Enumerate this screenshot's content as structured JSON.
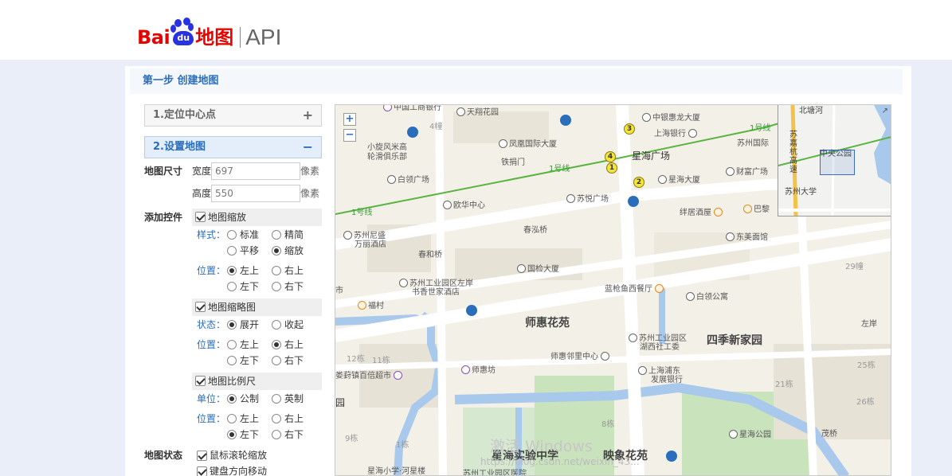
{
  "header": {
    "logo_bai": "Bai",
    "logo_du": "du",
    "logo_ditu": "地图",
    "logo_api": "API"
  },
  "step_title": "第一步 创建地图",
  "panel": {
    "section1": "1.定位中心点",
    "section1_sign": "+",
    "section2": "2.设置地图",
    "section2_sign": "−",
    "map_size_label": "地图尺寸",
    "width_label": "宽度：",
    "width_value": "697",
    "height_label": "高度：",
    "height_value": "550",
    "unit": "像素",
    "add_controls_label": "添加控件",
    "zoom_control": "地图缩放",
    "style_label": "样式：",
    "style_options": [
      "标准",
      "精简",
      "平移",
      "缩放"
    ],
    "position_label": "位置：",
    "position_options": [
      "左上",
      "右上",
      "左下",
      "右下"
    ],
    "overview_control": "地图缩略图",
    "state_label": "状态：",
    "state_options": [
      "展开",
      "收起"
    ],
    "scale_control": "地图比例尺",
    "scale_unit_label": "单位：",
    "scale_unit_options": [
      "公制",
      "英制"
    ],
    "map_state_label": "地图状态",
    "map_state_options": [
      "鼠标滚轮缩放",
      "键盘方向移动"
    ]
  },
  "map": {
    "zoom_in": "+",
    "zoom_out": "−",
    "labels": {
      "zhongguo_bank": "中国工商银行",
      "tianxiang": "天翔花园",
      "zhongyin": "中银惠龙大厦",
      "shanghai_bank": "上海银行",
      "suzhou_intl": "苏州国际",
      "caifu": "财富广场",
      "building_4": "4幢",
      "xiaoxuanfeng": "小旋风米高",
      "lunhua": "轮滑俱乐部",
      "fenghuang": "凤凰国际大厦",
      "tiexiu": "铁捐门",
      "xinghai_sq": "星海广场",
      "xinghai_tower": "星海大厦",
      "line1_a": "1号线",
      "line1_b": "1号线",
      "line1_c": "1号线",
      "bailing_sq": "白领广场",
      "suyue": "苏悦广场",
      "ouhua": "欧华中心",
      "banju": "绊居酒屋",
      "bakyo": "巴黎",
      "ninisheng": "苏州尼盛",
      "wanli": "万丽酒店",
      "chunliuqiao": "春泓桥",
      "chunhe": "春和桥",
      "dongmei": "东美面馆",
      "suzhou_park": "苏州工业园区左岸",
      "shuxiang": "书香世家酒店",
      "guojian": "国检大厦",
      "landyu": "蓝枪鱼西餐厅",
      "bailing_apt": "白领公寓",
      "fucun": "福村",
      "shihui": "师惠花苑",
      "suzhou_park2": "苏州工业园区",
      "hexi": "湖西社工委",
      "siji": "四季新家园",
      "shihui_li": "师惠邻里中心",
      "loufang": "娄葑镇百倍超市",
      "shihuifang": "师惠坊",
      "shpudong": "上海浦东",
      "fazhan": "发展银行",
      "xinghai_park": "星海公园",
      "xinghai_school": "星海实验中学",
      "yingxiang": "映象花苑",
      "xinghai_primary": "星海小学·河星楼",
      "suzhou_hospital": "苏州工业园区医院",
      "market": "市",
      "yuan": "园",
      "b11": "11栋",
      "b12": "12栋",
      "b8": "8栋",
      "b9": "9栋",
      "b1": "1栋",
      "b29": "29幢",
      "b25": "25栋",
      "b21": "21栋",
      "b26": "26栋",
      "zuoan": "左岸",
      "maoqiao": "茂桥"
    },
    "metro": [
      "1",
      "2",
      "3",
      "4"
    ]
  },
  "overview": {
    "beijiao": "北塘河",
    "zhongyang_park": "中央公园",
    "su_jia_hang": "苏嘉杭高速",
    "suzhou_univ": "苏州大学"
  },
  "watermark": "激活 Windows",
  "csdn": "https://blog.csdn.net/weixin_43...",
  "colors": {
    "brand_red": "#e10602",
    "brand_blue": "#2932e1",
    "accent": "#2a6ebb",
    "metro_line": "#59b33f",
    "water": "#a8c8ec",
    "green": "#c9e3bd"
  }
}
